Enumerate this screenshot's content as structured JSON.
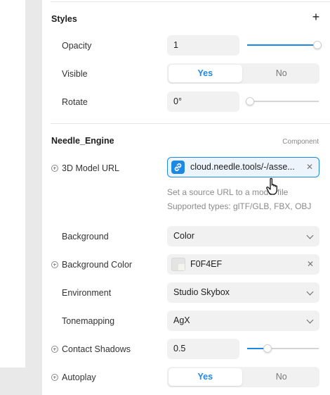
{
  "styles": {
    "title": "Styles",
    "add_icon": "plus-icon",
    "opacity": {
      "label": "Opacity",
      "value": "1",
      "slider_fraction": 1.0
    },
    "visible": {
      "label": "Visible",
      "options": [
        "Yes",
        "No"
      ],
      "selected": "Yes"
    },
    "rotate": {
      "label": "Rotate",
      "value": "0°",
      "slider_fraction": 0.0
    }
  },
  "needle": {
    "title": "Needle_Engine",
    "tag": "Component",
    "model_url": {
      "label": "3D Model URL",
      "value": "cloud.needle.tools/-/asse...",
      "icon": "link-icon",
      "helper_line1": "Set a source URL to a model file",
      "helper_line2": "Supported types: glTF/GLB, FBX, OBJ"
    },
    "background": {
      "label": "Background",
      "value": "Color"
    },
    "background_color": {
      "label": "Background Color",
      "value": "F0F4EF",
      "swatch": "#f0f4ef"
    },
    "environment": {
      "label": "Environment",
      "value": "Studio Skybox"
    },
    "tonemapping": {
      "label": "Tonemapping",
      "value": "AgX"
    },
    "contact_shadows": {
      "label": "Contact Shadows",
      "value": "0.5",
      "slider_fraction": 0.3
    },
    "autoplay": {
      "label": "Autoplay",
      "options": [
        "Yes",
        "No"
      ],
      "selected": "Yes"
    }
  },
  "colors": {
    "accent": "#1e88e5",
    "field_bg": "#f1f1f1",
    "gutter": "#e9e9e9"
  }
}
